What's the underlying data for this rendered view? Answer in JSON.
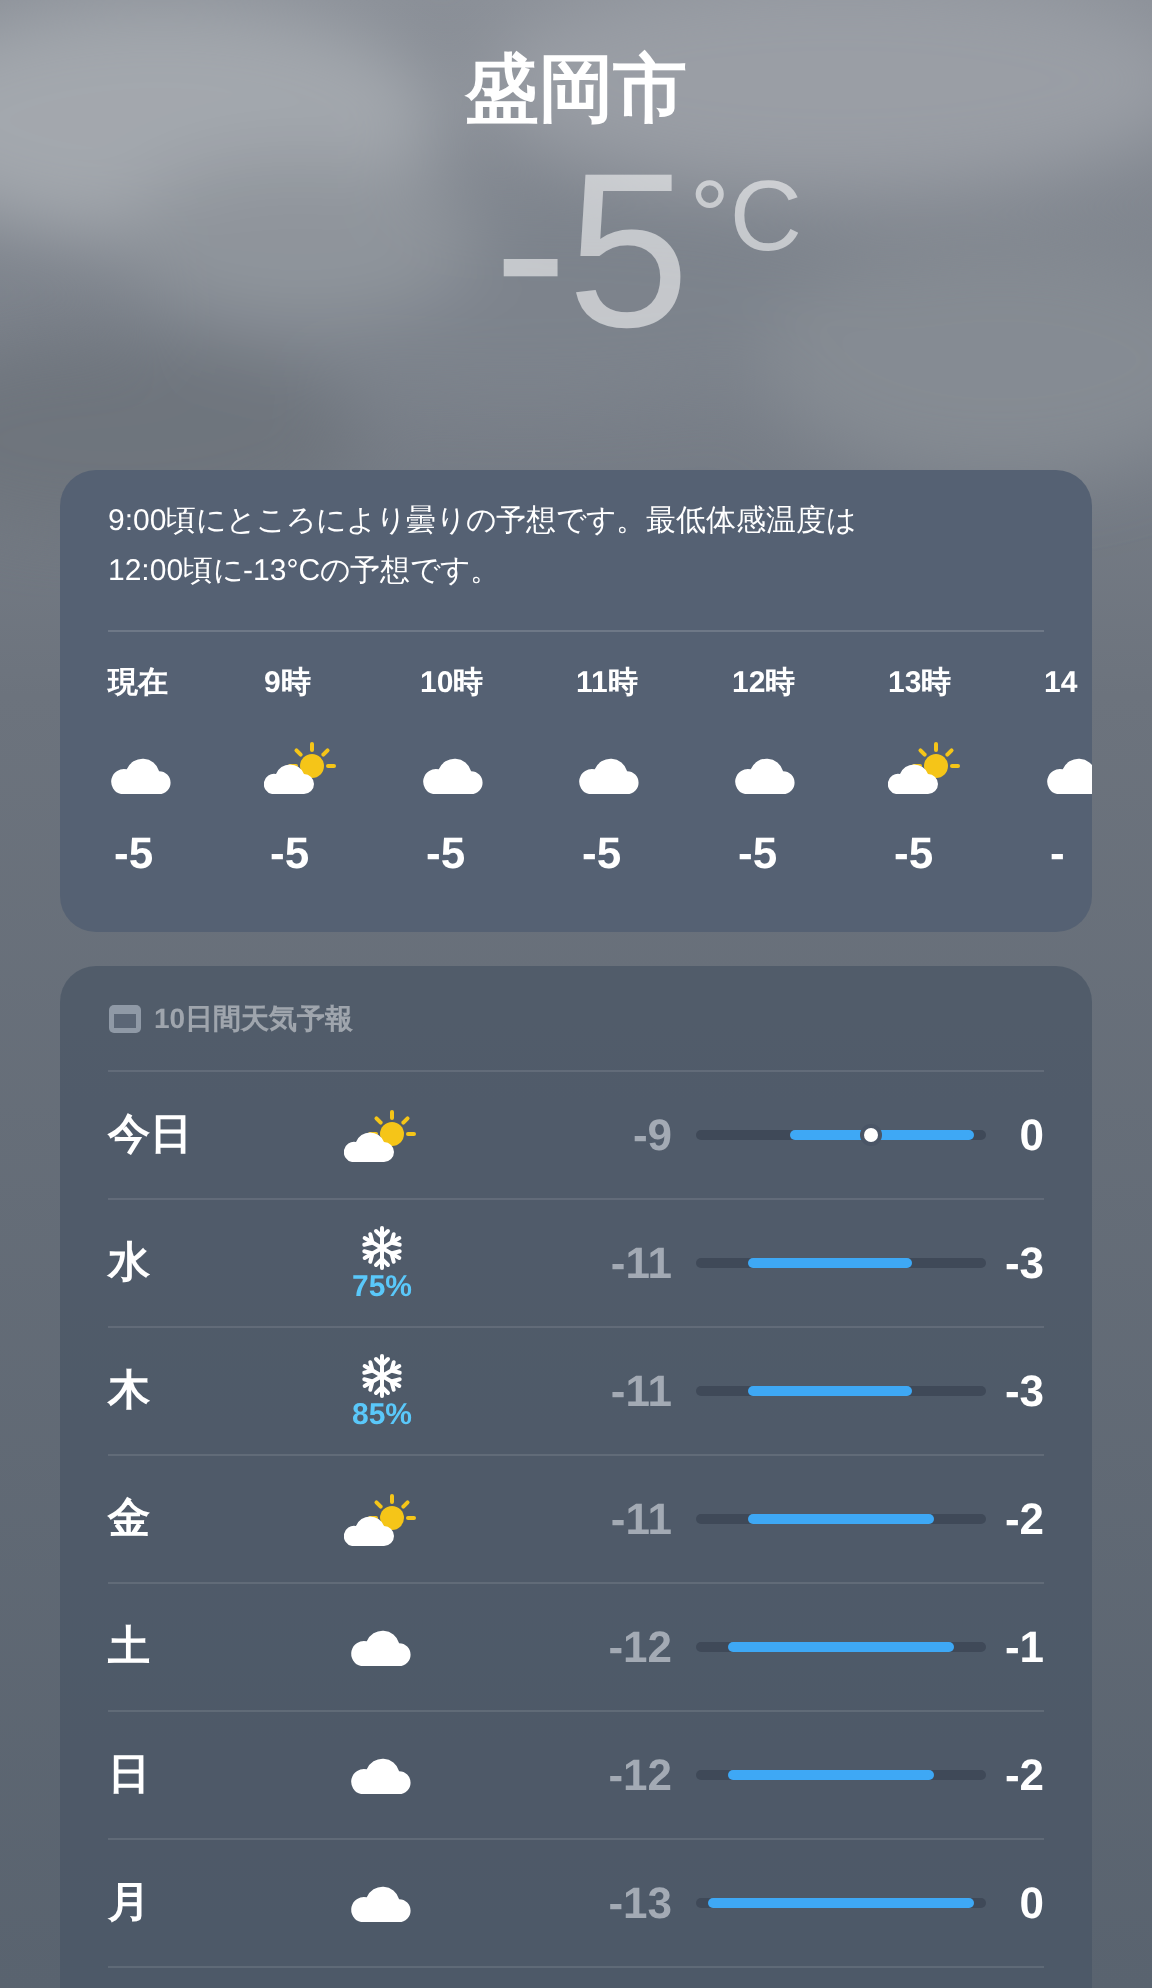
{
  "city": "盛岡市",
  "temperature": "-5",
  "unit": "°C",
  "hourly": {
    "summary": "9:00頃にところにより曇りの予想です。最低体感温度は12:00頃に-13°Cの予想です。",
    "hours": [
      {
        "time": "現在",
        "kind": "cloudy",
        "temp": "-5"
      },
      {
        "time": "9時",
        "kind": "partly_cloudy",
        "temp": "-5"
      },
      {
        "time": "10時",
        "kind": "cloudy",
        "temp": "-5"
      },
      {
        "time": "11時",
        "kind": "cloudy",
        "temp": "-5"
      },
      {
        "time": "12時",
        "kind": "cloudy",
        "temp": "-5"
      },
      {
        "time": "13時",
        "kind": "partly_cloudy",
        "temp": "-5"
      },
      {
        "time": "14",
        "kind": "cloudy",
        "temp": "-"
      }
    ]
  },
  "forecast": {
    "title": "10日間天気予報",
    "days": [
      {
        "day": "今日",
        "kind": "partly_cloudy",
        "low": "-9",
        "high": "0",
        "current": true
      },
      {
        "day": "水",
        "kind": "snow",
        "precip": "75%",
        "low": "-11",
        "high": "-3",
        "current": false
      },
      {
        "day": "木",
        "kind": "snow",
        "precip": "85%",
        "low": "-11",
        "high": "-3",
        "current": false
      },
      {
        "day": "金",
        "kind": "partly_cloudy",
        "low": "-11",
        "high": "-2",
        "current": false
      },
      {
        "day": "土",
        "kind": "cloudy",
        "low": "-12",
        "high": "-1",
        "current": false
      },
      {
        "day": "日",
        "kind": "cloudy",
        "low": "-12",
        "high": "-2",
        "current": false
      },
      {
        "day": "月",
        "kind": "cloudy",
        "low": "-13",
        "high": "0",
        "current": false
      }
    ]
  }
}
